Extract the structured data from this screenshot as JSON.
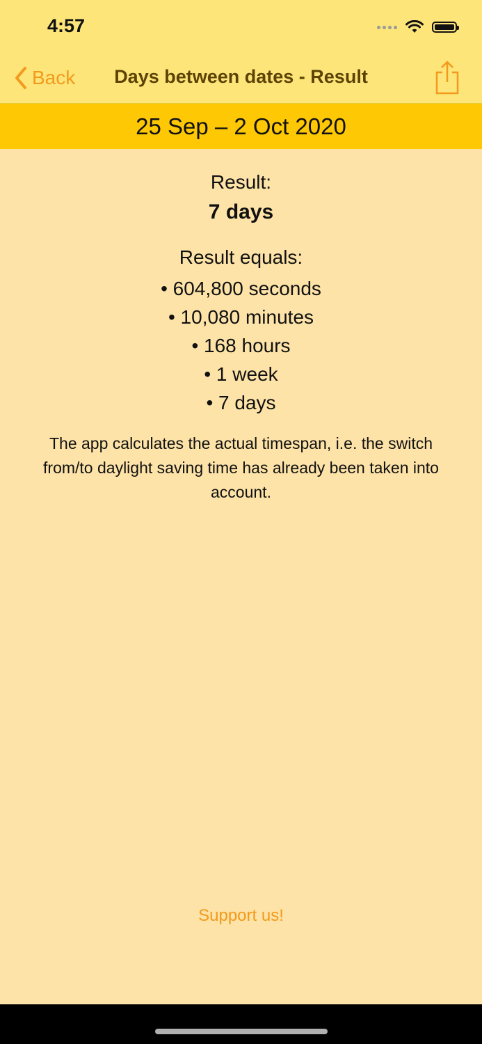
{
  "status": {
    "time": "4:57"
  },
  "nav": {
    "back_label": "Back",
    "title": "Days between dates - Result",
    "share_icon": "share-icon"
  },
  "date_range": "25 Sep – 2 Oct 2020",
  "result": {
    "label": "Result:",
    "value": "7 days",
    "equals_label": "Result equals:",
    "equals": [
      "• 604,800 seconds",
      "• 10,080 minutes",
      "• 168 hours",
      "• 1 week",
      "• 7 days"
    ],
    "note": "The app calculates the actual timespan, i.e. the switch from/to daylight saving time has already been taken into account."
  },
  "support_label": "Support us!",
  "colors": {
    "accent": "#F39A1C",
    "nav_background": "#FDE57A",
    "date_band": "#FFC804",
    "content_background": "#FDE3A7"
  }
}
